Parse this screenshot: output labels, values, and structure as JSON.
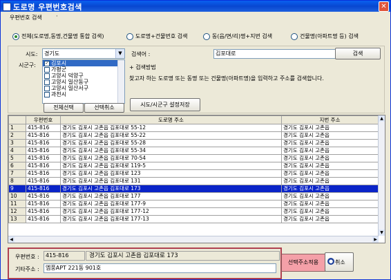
{
  "window": {
    "title": "도로명 우편번호검색",
    "close": "✕"
  },
  "menu": {
    "item": "우편번호 검색",
    "dot": "·"
  },
  "search_modes": [
    {
      "label": "전체(도로명,동명,건물명 통합 검색)",
      "selected": true
    },
    {
      "label": "도로명+건물번호 검색",
      "selected": false
    },
    {
      "label": "동(읍/면/리)명+지번 검색",
      "selected": false
    },
    {
      "label": "건물명(아파트명 등) 검색",
      "selected": false
    }
  ],
  "filters": {
    "sido_label": "시도:",
    "sido_value": "경기도",
    "sigungu_label": "시군구:",
    "sigungu_items": [
      {
        "label": "김포시",
        "checked": true,
        "selected": true
      },
      {
        "label": "가평군",
        "checked": false,
        "selected": false
      },
      {
        "label": "고양시 덕양구",
        "checked": false,
        "selected": false
      },
      {
        "label": "고양시 일산동구",
        "checked": false,
        "selected": false
      },
      {
        "label": "고양시 일산서구",
        "checked": false,
        "selected": false
      },
      {
        "label": "과천시",
        "checked": false,
        "selected": false
      }
    ],
    "select_all": "전체선택",
    "deselect": "선택취소",
    "keyword_label": "검색어 :",
    "keyword_value": "김포대로",
    "search_button": "검색",
    "method_title": "+ 검색방법",
    "method_text": "찾고자 하는 도로명 또는 동명 또는 건물명(아파트명)을 입력하고 주소를 검색합니다.",
    "save_region": "시도/시군구 설정저장"
  },
  "grid": {
    "columns": [
      "",
      "우편번호",
      "도로명 주소",
      "지번 주소"
    ],
    "rows": [
      {
        "no": "1",
        "zip": "415-816",
        "road": "경기도 김포시 고촌읍 김포대로 55-12",
        "jibun": "경기도 김포시 고촌읍"
      },
      {
        "no": "2",
        "zip": "415-816",
        "road": "경기도 김포시 고촌읍 김포대로 55-22",
        "jibun": "경기도 김포시 고촌읍"
      },
      {
        "no": "3",
        "zip": "415-816",
        "road": "경기도 김포시 고촌읍 김포대로 55-28",
        "jibun": "경기도 김포시 고촌읍"
      },
      {
        "no": "4",
        "zip": "415-816",
        "road": "경기도 김포시 고촌읍 김포대로 55-34",
        "jibun": "경기도 김포시 고촌읍"
      },
      {
        "no": "5",
        "zip": "415-816",
        "road": "경기도 김포시 고촌읍 김포대로 70-54",
        "jibun": "경기도 김포시 고촌읍"
      },
      {
        "no": "6",
        "zip": "415-816",
        "road": "경기도 김포시 고촌읍 김포대로 119-5",
        "jibun": "경기도 김포시 고촌읍"
      },
      {
        "no": "7",
        "zip": "415-816",
        "road": "경기도 김포시 고촌읍 김포대로 123",
        "jibun": "경기도 김포시 고촌읍"
      },
      {
        "no": "8",
        "zip": "415-816",
        "road": "경기도 김포시 고촌읍 김포대로 131",
        "jibun": "경기도 김포시 고촌읍"
      },
      {
        "no": "9",
        "zip": "415-816",
        "road": "경기도 김포시 고촌읍 김포대로 173",
        "jibun": "경기도 김포시 고촌읍",
        "selected": true
      },
      {
        "no": "10",
        "zip": "415-816",
        "road": "경기도 김포시 고촌읍 김포대로 177",
        "jibun": "경기도 김포시 고촌읍"
      },
      {
        "no": "11",
        "zip": "415-816",
        "road": "경기도 김포시 고촌읍 김포대로 177-9",
        "jibun": "경기도 김포시 고촌읍"
      },
      {
        "no": "12",
        "zip": "415-816",
        "road": "경기도 김포시 고촌읍 김포대로 177-12",
        "jibun": "경기도 김포시 고촌읍"
      },
      {
        "no": "13",
        "zip": "415-816",
        "road": "경기도 김포시 고촌읍 김포대로 177-13",
        "jibun": "경기도 김포시 고촌읍"
      }
    ]
  },
  "result": {
    "zip_label": "우편번호 :",
    "zip_value": "415-816",
    "address_value": "경기도 김포시 고촌읍 김포대로 173",
    "other_label": "기타주소 :",
    "other_value": "엠풍APT 221동 901호"
  },
  "actions": {
    "apply": "선택주소적용",
    "cancel": "취소"
  },
  "colors": {
    "title_blue": "#0847d0",
    "selection_blue": "#0a24c8",
    "apply_pink": "#f4a0a8",
    "highlight_border": "#b04050"
  }
}
